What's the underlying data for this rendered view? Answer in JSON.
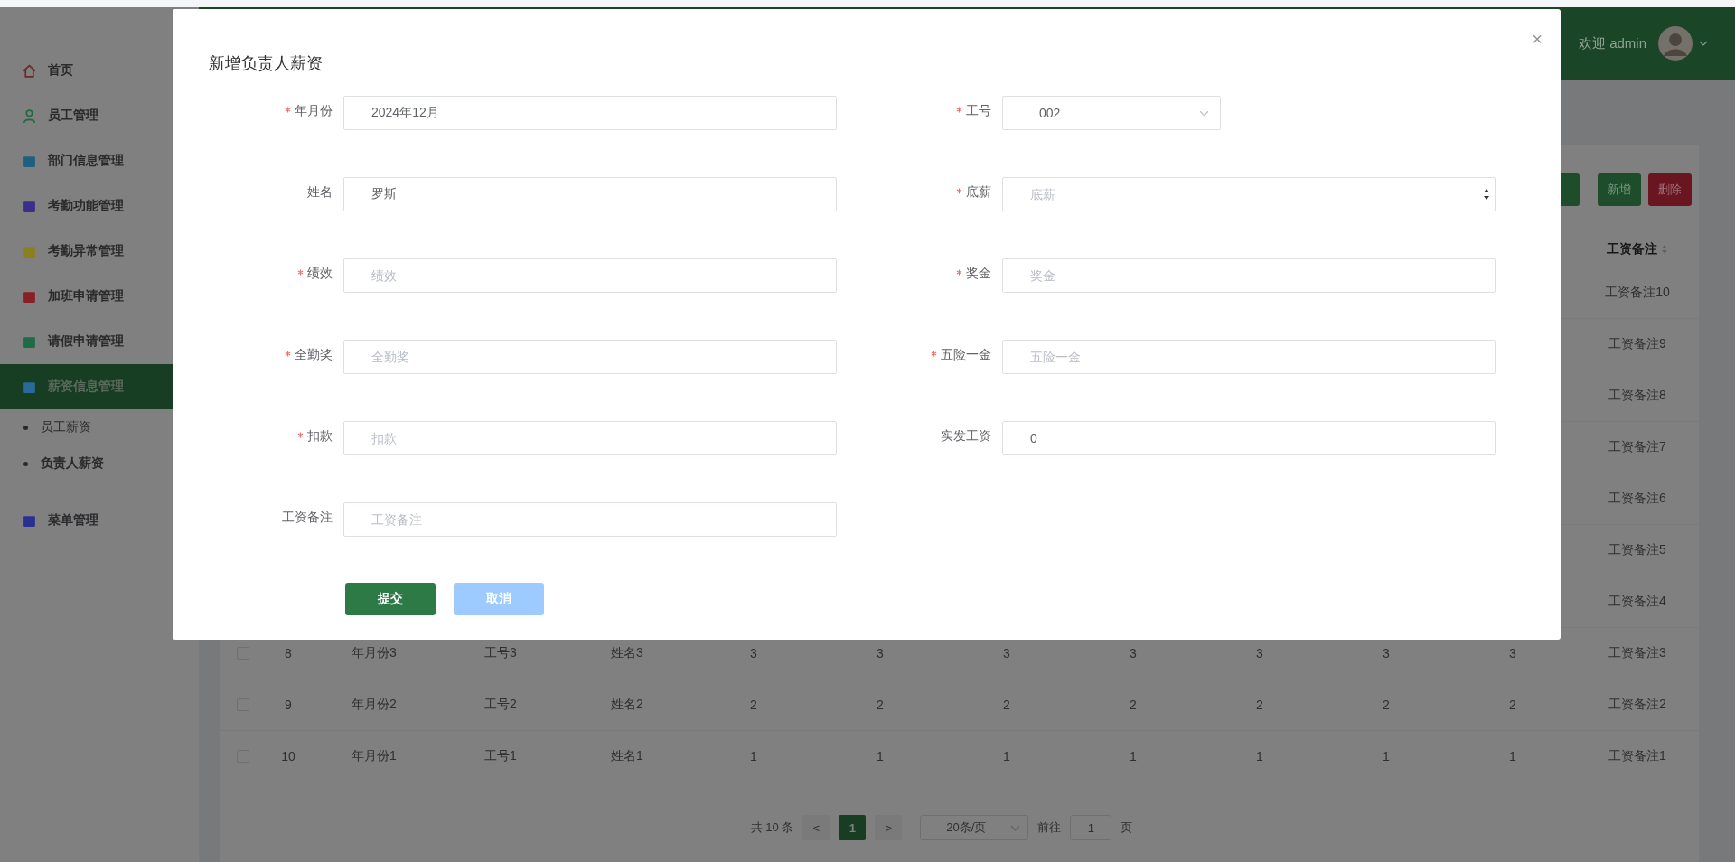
{
  "sidebar": {
    "items": [
      {
        "label": "首页",
        "color": "#6b2a28",
        "selected": false
      },
      {
        "label": "员工管理",
        "color": "#1f6a40",
        "selected": false
      },
      {
        "label": "部门信息管理",
        "color": "#1f6080",
        "selected": false
      },
      {
        "label": "考勤功能管理",
        "color": "#3a2f8a",
        "selected": false
      },
      {
        "label": "考勤异常管理",
        "color": "#8a8020",
        "selected": false
      },
      {
        "label": "加班申请管理",
        "color": "#8a1f25",
        "selected": false
      },
      {
        "label": "请假申请管理",
        "color": "#1f6a48",
        "selected": false
      },
      {
        "label": "薪资信息管理",
        "color": "#2a6a9a",
        "selected": true,
        "expanded": true,
        "children": [
          {
            "label": "员工薪资",
            "selected": false
          },
          {
            "label": "负责人薪资",
            "selected": true
          }
        ]
      },
      {
        "label": "菜单管理",
        "color": "#2a3090",
        "selected": false
      }
    ]
  },
  "header": {
    "greeting": "欢迎 admin"
  },
  "toolbar": {
    "buttons": [
      {
        "kind": "primary"
      },
      {
        "label": "新增",
        "kind": "primary"
      },
      {
        "label": "删除",
        "kind": "danger"
      }
    ]
  },
  "table": {
    "remark_header": "工资备注",
    "rows": [
      {
        "remark": "工资备注10"
      },
      {
        "remark": "工资备注9"
      },
      {
        "remark": "工资备注8"
      },
      {
        "remark": "工资备注7"
      },
      {
        "remark": "工资备注6"
      },
      {
        "remark": "工资备注5"
      },
      {
        "remark": "工资备注4"
      },
      {
        "checked": false,
        "cells": [
          "8",
          "年月份3",
          "工号3",
          "姓名3",
          "3",
          "3",
          "3",
          "3",
          "3",
          "3",
          "3"
        ],
        "remark": "工资备注3"
      },
      {
        "checked": false,
        "cells": [
          "9",
          "年月份2",
          "工号2",
          "姓名2",
          "2",
          "2",
          "2",
          "2",
          "2",
          "2",
          "2"
        ],
        "remark": "工资备注2"
      },
      {
        "checked": false,
        "cells": [
          "10",
          "年月份1",
          "工号1",
          "姓名1",
          "1",
          "1",
          "1",
          "1",
          "1",
          "1",
          "1"
        ],
        "remark": "工资备注1"
      }
    ]
  },
  "pagination": {
    "total": "共 10 条",
    "prev": "<",
    "pages": [
      {
        "label": "1",
        "selected": true
      }
    ],
    "next": ">",
    "page_size": "20条/页",
    "goto_label": "前往",
    "goto_value": "1",
    "goto_suffix": "页"
  },
  "modal": {
    "title": "新增负责人薪资",
    "close": "×",
    "fields": [
      {
        "label": "年月份",
        "required": true,
        "kind": "text",
        "value": "2024年12月"
      },
      {
        "label": "工号",
        "required": true,
        "kind": "select",
        "value": "002"
      },
      {
        "label": "姓名",
        "required": false,
        "kind": "text",
        "value": "罗斯"
      },
      {
        "label": "底薪",
        "required": true,
        "kind": "number",
        "placeholder": "底薪"
      },
      {
        "label": "绩效",
        "required": true,
        "kind": "text",
        "placeholder": "绩效"
      },
      {
        "label": "奖金",
        "required": true,
        "kind": "text",
        "placeholder": "奖金"
      },
      {
        "label": "全勤奖",
        "required": true,
        "kind": "text",
        "placeholder": "全勤奖"
      },
      {
        "label": "五险一金",
        "required": true,
        "kind": "text",
        "placeholder": "五险一金"
      },
      {
        "label": "扣款",
        "required": true,
        "kind": "text",
        "placeholder": "扣款"
      },
      {
        "label": "实发工资",
        "required": false,
        "kind": "text",
        "value": "0"
      },
      {
        "label": "工资备注",
        "required": false,
        "kind": "text",
        "placeholder": "工资备注"
      }
    ],
    "buttons": [
      {
        "label": "提交",
        "kind": "primary"
      },
      {
        "label": "取消",
        "kind": "light"
      }
    ]
  }
}
